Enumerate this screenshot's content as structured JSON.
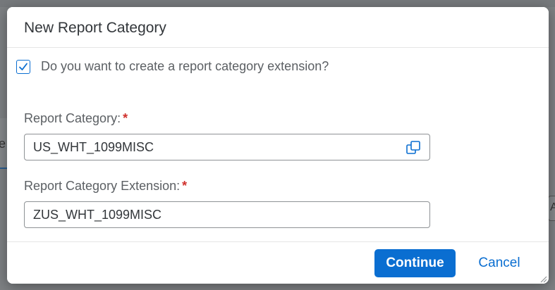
{
  "background": {
    "left_tab_char": "e",
    "right_button_char": "Ac"
  },
  "dialog": {
    "title": "New Report Category",
    "checkbox": {
      "label": "Do you want to create a report category extension?",
      "checked": true
    },
    "fields": [
      {
        "label": "Report Category:",
        "required_marker": "*",
        "value": "US_WHT_1099MISC",
        "icon": "value-help-icon"
      },
      {
        "label": "Report Category Extension:",
        "required_marker": "*",
        "value": "ZUS_WHT_1099MISC"
      }
    ],
    "footer": {
      "continue_label": "Continue",
      "cancel_label": "Cancel"
    }
  },
  "colors": {
    "accent": "#0a6ed1",
    "required": "#d0312d",
    "text": "#32363a",
    "label": "#5b5f63"
  }
}
